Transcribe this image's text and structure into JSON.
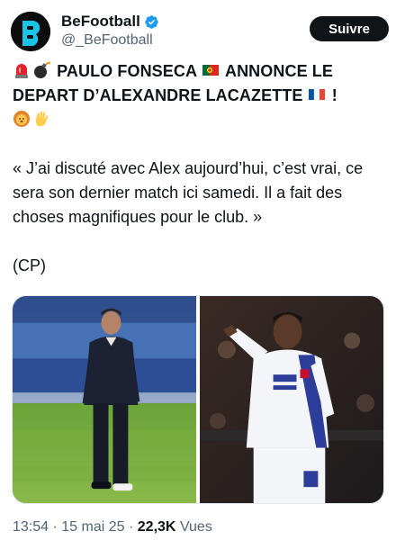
{
  "account": {
    "display_name": "BeFootball",
    "handle": "@_BeFootball",
    "verified": true,
    "avatar_icon": "befootball-logo",
    "accent_color": "#1d9bf0"
  },
  "actions": {
    "follow_label": "Suivre"
  },
  "post": {
    "headline_line1": "PAULO FONSECA",
    "headline_mid": "ANNONCE LE",
    "headline_line2": "DEPART D’ALEXANDRE LACAZETTE",
    "headline_end": "!",
    "quote": "« J’ai discuté avec Alex aujourd’hui, c’est vrai, ce sera son dernier match ici samedi. Il a fait des choses magnifiques pour le club. »",
    "signoff": "(CP)",
    "emojis": [
      "rotating-light",
      "bomb",
      "portugal-flag",
      "france-flag",
      "lion-face",
      "waving-hand"
    ]
  },
  "media": {
    "count": 2,
    "photos": [
      "coach-on-pitch-photo",
      "player-celebrating-photo"
    ]
  },
  "footer": {
    "time": "13:54",
    "separator": "·",
    "date": "15 mai 25",
    "views": "22,3K",
    "views_label": "Vues"
  }
}
